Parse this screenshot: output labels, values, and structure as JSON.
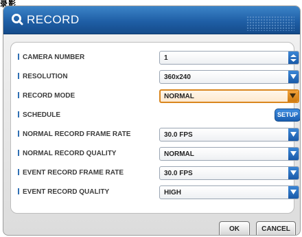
{
  "caption": "录影",
  "window": {
    "title": "RECORD",
    "title_icon": "search-q-icon"
  },
  "fields": [
    {
      "label": "CAMERA NUMBER",
      "value": "1",
      "control": "spinner",
      "active": false
    },
    {
      "label": "RESOLUTION",
      "value": "360x240",
      "control": "dropdown",
      "active": false
    },
    {
      "label": "RECORD MODE",
      "value": "NORMAL",
      "control": "dropdown",
      "active": true
    },
    {
      "label": "SCHEDULE",
      "value": "",
      "control": "button",
      "button_label": "SETUP",
      "active": false
    },
    {
      "label": "NORMAL RECORD FRAME RATE",
      "value": "30.0 FPS",
      "control": "dropdown",
      "active": false
    },
    {
      "label": "NORMAL RECORD QUALITY",
      "value": "NORMAL",
      "control": "dropdown",
      "active": false
    },
    {
      "label": "EVENT RECORD FRAME RATE",
      "value": "30.0 FPS",
      "control": "dropdown",
      "active": false
    },
    {
      "label": "EVENT RECORD QUALITY",
      "value": "HIGH",
      "control": "dropdown",
      "active": false
    }
  ],
  "buttons": {
    "ok": "OK",
    "cancel": "CANCEL"
  },
  "colors": {
    "title_bar": "#1f5fa6",
    "accent_active": "#d9861e",
    "dropdown_arrow": "#1a5aa8"
  }
}
